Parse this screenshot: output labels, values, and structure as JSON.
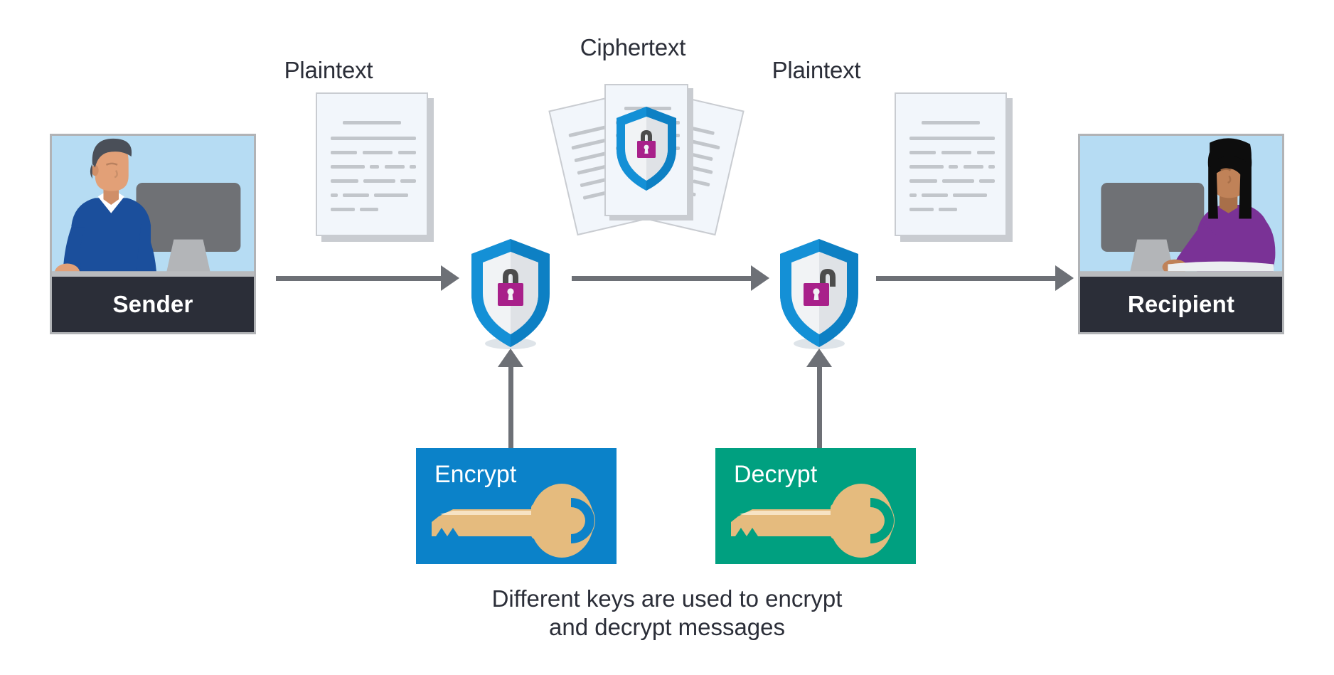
{
  "diagram": {
    "title_caption": "Different keys are used to encrypt\nand decrypt messages",
    "labels": {
      "plaintext_left": "Plaintext",
      "ciphertext": "Ciphertext",
      "plaintext_right": "Plaintext"
    },
    "actors": [
      {
        "id": "sender",
        "caption": "Sender",
        "art": "man-at-desktop-computer"
      },
      {
        "id": "recipient",
        "caption": "Recipient",
        "art": "woman-at-desktop-computer"
      }
    ],
    "shields": [
      {
        "id": "encrypt-shield",
        "icon": "shield-closed-padlock-icon",
        "state": "locked"
      },
      {
        "id": "decrypt-shield",
        "icon": "shield-open-padlock-icon",
        "state": "unlocked"
      }
    ],
    "keys": [
      {
        "id": "encrypt-key",
        "label": "Encrypt",
        "color": "#0b82c9",
        "icon": "key-icon"
      },
      {
        "id": "decrypt-key",
        "label": "Decrypt",
        "color": "#00a080",
        "icon": "key-icon"
      }
    ],
    "flow_arrows": [
      {
        "id": "arrow-sender-to-encrypt",
        "direction": "right"
      },
      {
        "id": "arrow-encrypt-to-decrypt",
        "direction": "right"
      },
      {
        "id": "arrow-decrypt-to-recipient",
        "direction": "right"
      },
      {
        "id": "arrow-encrypt-key-up",
        "direction": "up"
      },
      {
        "id": "arrow-decrypt-key-up",
        "direction": "up"
      }
    ],
    "colors": {
      "background": "#ffffff",
      "text": "#2b2e38",
      "panel_sky": "#b6dcf3",
      "panel_border": "#b1b3b6",
      "caption_bar": "#2b2e38",
      "arrow_gray": "#6d7076",
      "doc_paper": "#f2f6fb",
      "doc_border": "#c9ccd1",
      "doc_line": "#c2c6cb",
      "shield_blue": "#0d80c4",
      "shield_blue_dark": "#0a6ba6",
      "shield_face": "#f1f3f5",
      "shield_face_shade": "#dfe2e6",
      "lock_magenta": "#a8208a",
      "lock_shackle": "#4c4c4c",
      "key_gold": "#e5bb7e",
      "key_gold_light": "#f7e3c4",
      "encrypt_blue": "#0b82c9",
      "decrypt_teal": "#00a080",
      "sender_shirt": "#1b4f9c",
      "recipient_shirt": "#7a3296",
      "skin_sender": "#e2a077",
      "skin_recipient": "#c08258",
      "hair_sender": "#4a4f58",
      "hair_recipient": "#0d0d0d",
      "monitor": "#6f7175",
      "monitor_stand": "#b3b5b8"
    }
  }
}
